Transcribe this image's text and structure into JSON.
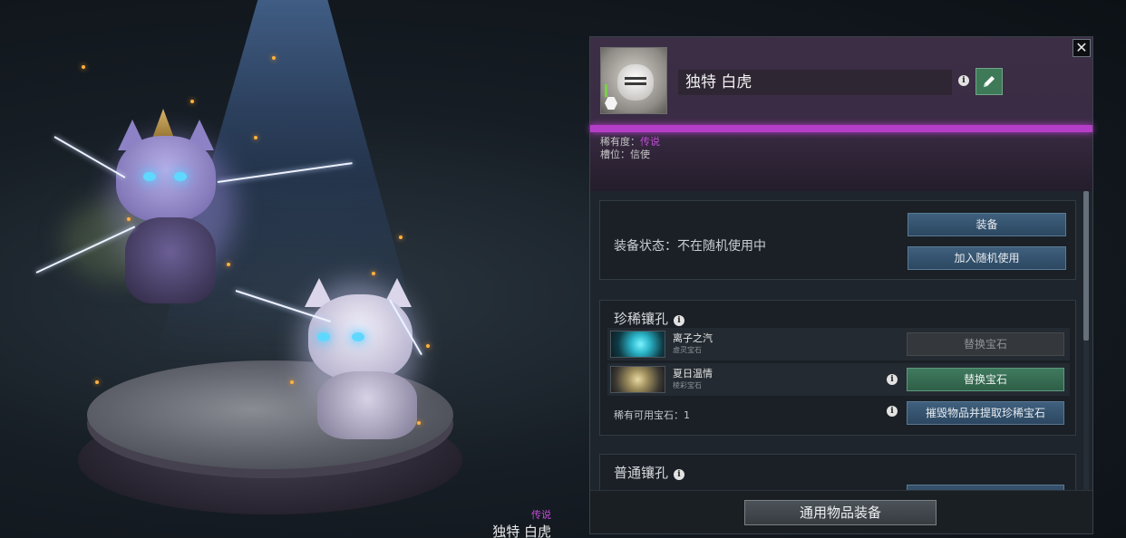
{
  "scene": {
    "rarity": "传说",
    "name": "独特 白虎"
  },
  "panel": {
    "close_label": "✕",
    "item_name": "独特 白虎",
    "rarity_label": "稀有度：",
    "rarity_value": "传说",
    "slot_line": "槽位：信使",
    "rarity_color": "#b53ec8"
  },
  "equip": {
    "status": "装备状态：不在随机使用中",
    "equip_label": "装备",
    "random_label": "加入随机使用"
  },
  "gems": {
    "title": "珍稀镶孔",
    "rows": [
      {
        "name": "离子之汽",
        "type": "虚灵宝石",
        "button": "替换宝石"
      },
      {
        "name": "夏日温情",
        "type": "棱彩宝石",
        "button": "替换宝石"
      }
    ],
    "available": "稀有可用宝石：1",
    "destroy_label": "摧毁物品并提取珍稀宝石"
  },
  "normal": {
    "title": "普通镶孔"
  },
  "footer": {
    "general_label": "通用物品装备"
  },
  "icons": {
    "info": "i",
    "edit": "pencil-icon",
    "close": "close-icon"
  }
}
